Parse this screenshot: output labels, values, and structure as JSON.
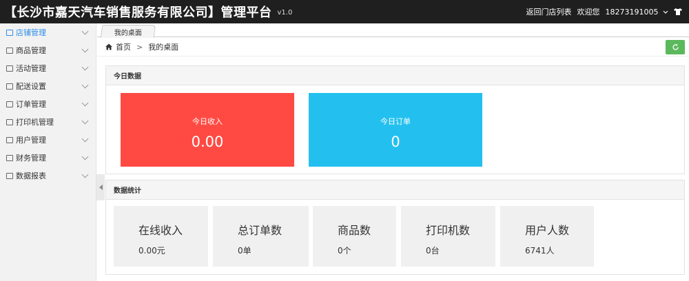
{
  "header": {
    "title": "【长沙市嘉天汽车销售服务有限公司】管理平台",
    "version": "v1.0",
    "back_link": "返回门店列表",
    "welcome": "欢迎您",
    "user": "18273191005"
  },
  "sidebar": {
    "items": [
      {
        "label": "店铺管理",
        "icon": "store-icon"
      },
      {
        "label": "商品管理",
        "icon": "goods-icon"
      },
      {
        "label": "活动管理",
        "icon": "activity-icon"
      },
      {
        "label": "配送设置",
        "icon": "truck-icon"
      },
      {
        "label": "订单管理",
        "icon": "order-icon"
      },
      {
        "label": "打印机管理",
        "icon": "printer-icon"
      },
      {
        "label": "用户管理",
        "icon": "user-icon"
      },
      {
        "label": "财务管理",
        "icon": "finance-icon"
      },
      {
        "label": "数据报表",
        "icon": "chart-icon"
      }
    ]
  },
  "tabs": [
    {
      "label": "我的桌面"
    }
  ],
  "breadcrumb": {
    "home": "首页",
    "separator": ">",
    "current": "我的桌面"
  },
  "today": {
    "title": "今日数据",
    "income_label": "今日收入",
    "income_value": "0.00",
    "orders_label": "今日订单",
    "orders_value": "0"
  },
  "stats": {
    "title": "数据统计",
    "items": [
      {
        "label": "在线收入",
        "value": "0.00元"
      },
      {
        "label": "总订单数",
        "value": "0单"
      },
      {
        "label": "商品数",
        "value": "0个"
      },
      {
        "label": "打印机数",
        "value": "0台"
      },
      {
        "label": "用户人数",
        "value": "6741人"
      }
    ]
  },
  "colors": {
    "header_bg": "#1f1f1f",
    "active": "#2f8ce8",
    "income_tile": "#ff4a43",
    "orders_tile": "#23c0ef",
    "refresh": "#5cb85c"
  }
}
